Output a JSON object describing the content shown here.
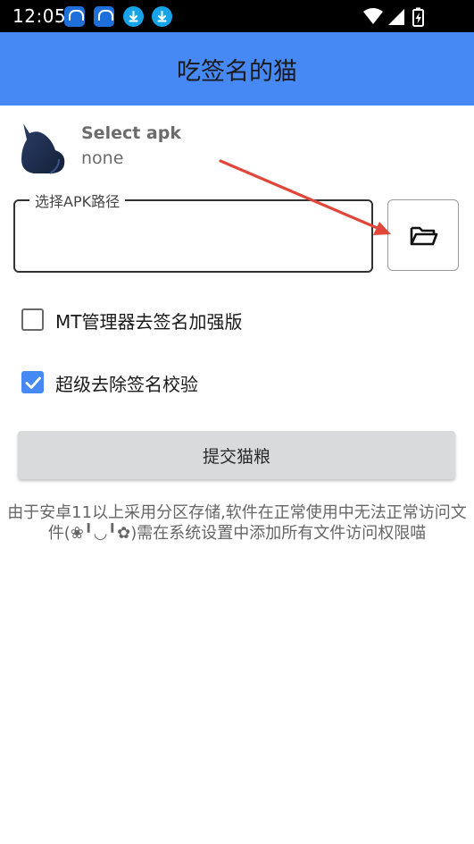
{
  "status_bar": {
    "time": "12:05",
    "notification_icons": [
      "app-icon",
      "app-icon",
      "download-icon",
      "download-icon"
    ],
    "right_icons": [
      "wifi-icon",
      "signal-icon",
      "battery-charging-icon"
    ]
  },
  "app_bar": {
    "title": "吃签名的猫",
    "color": "#4688f4"
  },
  "apk": {
    "title": "Select apk",
    "subtitle": "none",
    "icon": "cat-silhouette-icon"
  },
  "path_field": {
    "label": "选择APK路径",
    "value": ""
  },
  "browse_button": {
    "icon": "folder-open-icon"
  },
  "options": [
    {
      "label": "MT管理器去签名加强版",
      "checked": false
    },
    {
      "label": "超级去除签名校验",
      "checked": true
    }
  ],
  "submit": {
    "label": "提交猫粮"
  },
  "notice": {
    "text": "由于安卓11以上采用分区存储,软件在正常使用中无法正常访问文件(❀╹◡╹✿)需在系统设置中添加所有文件访问权限喵"
  },
  "colors": {
    "accent": "#4688f4",
    "annotation_arrow": "#e0473a"
  }
}
